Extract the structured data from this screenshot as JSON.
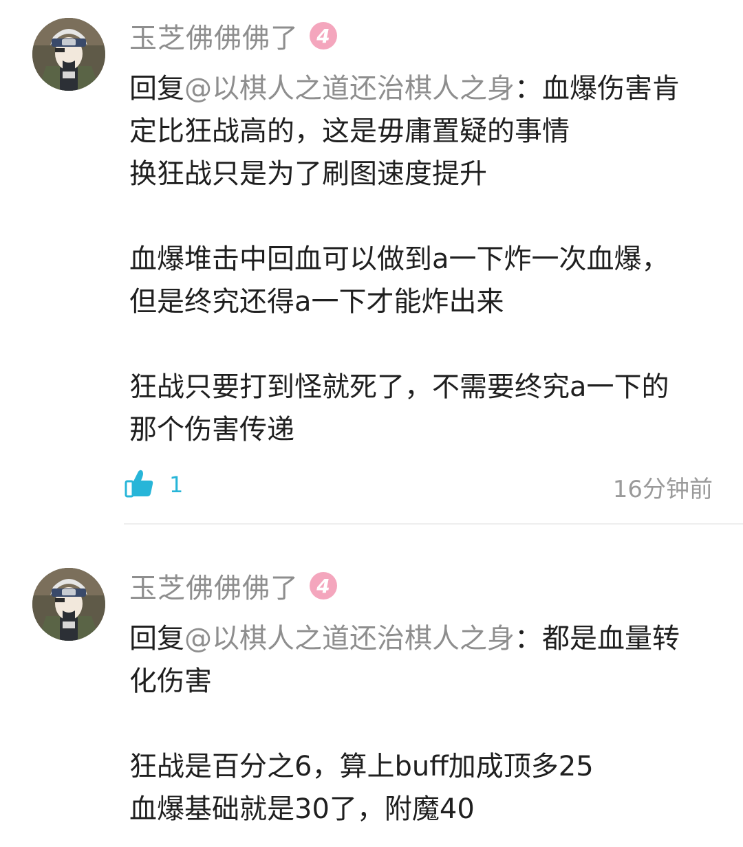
{
  "comments": [
    {
      "username": "玉芝佛佛佛了",
      "level": "4",
      "reply_prefix": "回复",
      "mention": "@以棋人之道还治棋人之身",
      "lines": [
        "：血爆伤害肯",
        "定比狂战高的，这是毋庸置疑的事情",
        "换狂战只是为了刷图速度提升",
        "",
        "血爆堆击中回血可以做到a一下炸一次血爆，",
        "但是终究还得a一下才能炸出来",
        "",
        "狂战只要打到怪就死了，不需要终究a一下的",
        "那个伤害传递"
      ],
      "likes": "1",
      "time": "16分钟前"
    },
    {
      "username": "玉芝佛佛佛了",
      "level": "4",
      "reply_prefix": "回复",
      "mention": "@以棋人之道还治棋人之身",
      "lines": [
        "：都是血量转",
        "化伤害",
        "",
        "狂战是百分之6，算上buff加成顶多25",
        "血爆基础就是30了，附魔40"
      ]
    }
  ],
  "colors": {
    "username": "#8e8e8e",
    "mention": "#8e8e8e",
    "body_text": "#1f1f1f",
    "level_badge": "#f4a6bd",
    "like_accent": "#27b5d8",
    "timestamp": "#9a9a9a",
    "divider": "#eeeeee"
  },
  "icons": {
    "like": "thumbs-up-icon",
    "avatar": "ninja-avatar"
  }
}
